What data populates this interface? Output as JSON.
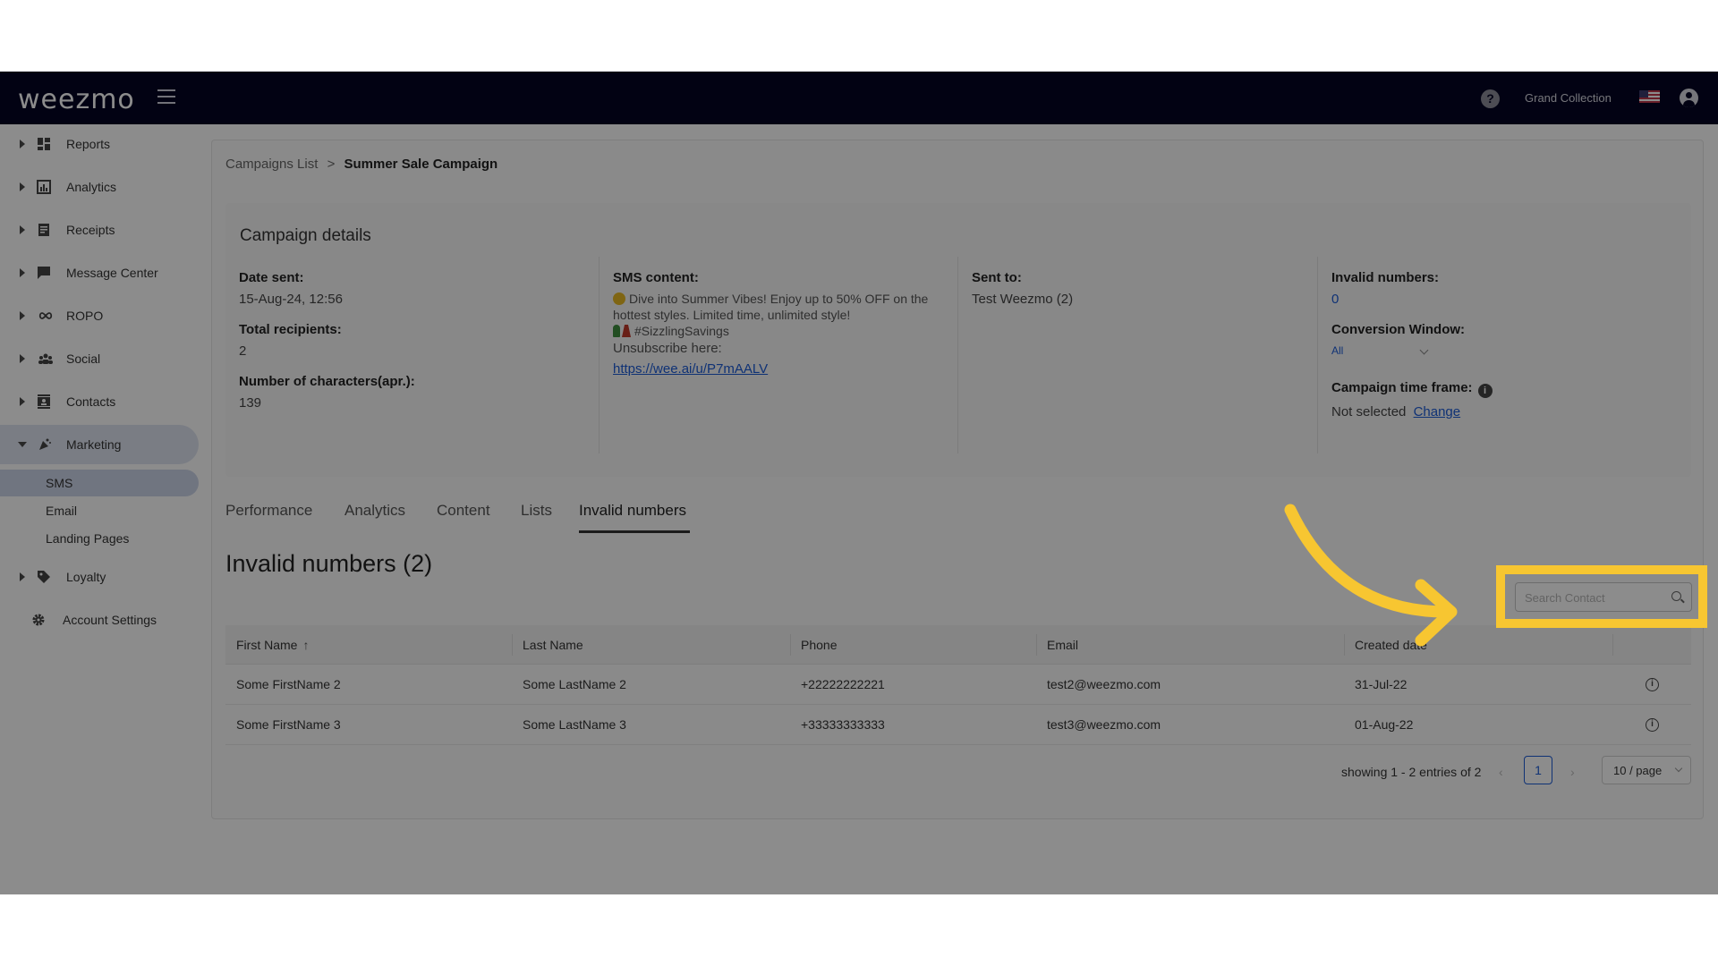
{
  "app": {
    "logo_text": "weezmo",
    "account_name": "Grand Collection",
    "help_icon": "question-circle-icon",
    "flag_icon": "us-flag-icon",
    "user_icon": "user-circle-icon"
  },
  "sidebar": {
    "items": [
      {
        "label": "Reports",
        "icon": "dashboard-icon"
      },
      {
        "label": "Analytics",
        "icon": "bar-chart-icon"
      },
      {
        "label": "Receipts",
        "icon": "receipt-icon"
      },
      {
        "label": "Message Center",
        "icon": "chat-icon"
      },
      {
        "label": "ROPO",
        "icon": "infinity-icon"
      },
      {
        "label": "Social",
        "icon": "people-icon"
      },
      {
        "label": "Contacts",
        "icon": "contacts-icon"
      },
      {
        "label": "Marketing",
        "icon": "megaphone-icon"
      },
      {
        "label": "Loyalty",
        "icon": "tag-icon"
      },
      {
        "label": "Account Settings",
        "icon": "gear-icon"
      }
    ],
    "marketing_sub": [
      {
        "label": "SMS"
      },
      {
        "label": "Email"
      },
      {
        "label": "Landing Pages"
      }
    ]
  },
  "breadcrumb": {
    "parent": "Campaigns List",
    "separator": ">",
    "current": "Summer Sale Campaign"
  },
  "details": {
    "title": "Campaign details",
    "date_sent_label": "Date sent:",
    "date_sent_value": "15-Aug-24, 12:56",
    "total_recipients_label": "Total recipients:",
    "total_recipients_value": "2",
    "num_chars_label": "Number of characters(apr.):",
    "num_chars_value": "139",
    "sms_content_label": "SMS content:",
    "sms_line1": "Dive into Summer Vibes! Enjoy up to 50% OFF on the hottest styles. Limited time, unlimited style!",
    "sms_hashtag": "#SizzlingSavings",
    "sms_unsubscribe": "Unsubscribe here:",
    "sms_link": "https://wee.ai/u/P7mAALV",
    "sent_to_label": "Sent to:",
    "sent_to_value": "Test Weezmo (2)",
    "invalid_numbers_label": "Invalid numbers:",
    "invalid_numbers_value": "0",
    "conversion_window_label": "Conversion Window:",
    "conversion_window_value": "All",
    "time_frame_label": "Campaign time frame:",
    "time_frame_value": "Not selected",
    "time_frame_change": "Change"
  },
  "tabs": [
    {
      "label": "Performance"
    },
    {
      "label": "Analytics"
    },
    {
      "label": "Content"
    },
    {
      "label": "Lists"
    },
    {
      "label": "Invalid numbers",
      "active": true
    }
  ],
  "section": {
    "title": "Invalid numbers (2)"
  },
  "search": {
    "placeholder": "Search Contact",
    "value": ""
  },
  "table": {
    "columns": [
      "First Name",
      "Last Name",
      "Phone",
      "Email",
      "Created date"
    ],
    "rows": [
      {
        "first": "Some FirstName 2",
        "last": "Some LastName 2",
        "phone": "+22222222221",
        "email": "test2@weezmo.com",
        "created": "31-Jul-22"
      },
      {
        "first": "Some FirstName 3",
        "last": "Some LastName 3",
        "phone": "+33333333333",
        "email": "test3@weezmo.com",
        "created": "01-Aug-22"
      }
    ]
  },
  "pager": {
    "summary": "showing 1 - 2 entries of 2",
    "prev": "‹",
    "page": "1",
    "next": "›",
    "page_size": "10 / page"
  },
  "colors": {
    "topbar": "#040524",
    "accent": "#1d5bd6",
    "highlight": "#f7c631"
  }
}
